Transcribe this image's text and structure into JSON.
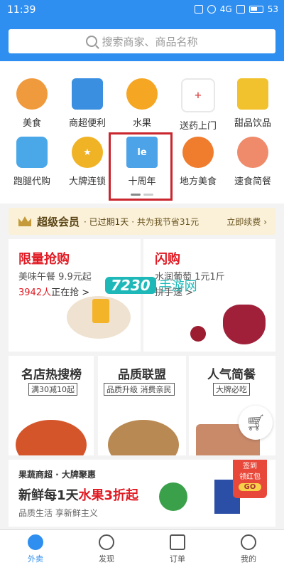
{
  "status": {
    "time": "11:39",
    "network": "4G",
    "battery": "53"
  },
  "search": {
    "placeholder": "搜索商家、商品名称"
  },
  "categories": [
    {
      "label": "美食",
      "icon": "food-icon",
      "color": "#f09a3e"
    },
    {
      "label": "商超便利",
      "icon": "store-icon",
      "color": "#3a8fe0"
    },
    {
      "label": "水果",
      "icon": "orange-icon",
      "color": "#f5a623"
    },
    {
      "label": "送药上门",
      "icon": "medicine-icon",
      "color": "#e05050"
    },
    {
      "label": "甜品饮品",
      "icon": "drink-icon",
      "color": "#f2c12e"
    },
    {
      "label": "跑腿代购",
      "icon": "errand-icon",
      "color": "#4aa8e8"
    },
    {
      "label": "大牌连锁",
      "icon": "star-icon",
      "color": "#f0b326"
    },
    {
      "label": "十周年",
      "icon": "anniversary-icon",
      "color": "#4da3e8",
      "badge": "le"
    },
    {
      "label": "地方美食",
      "icon": "bowl-icon",
      "color": "#f07c2e"
    },
    {
      "label": "速食简餐",
      "icon": "fastfood-icon",
      "color": "#ef8a6a"
    }
  ],
  "vip": {
    "title": "超级会员",
    "expired": "· 已过期1天",
    "saved": "· 共为我节省31元",
    "action": "立即续费 ›"
  },
  "flash_sale": {
    "title": "限量抢购",
    "sub": "美味午餐 9.9元起",
    "count": "3942人",
    "count_suffix": "正在抢 >"
  },
  "flash_buy": {
    "title": "闪购",
    "sub": "水润葡萄 1元1斤",
    "link": "拼手速 >"
  },
  "hot": [
    {
      "title": "名店热搜榜",
      "tag": "满30减10起"
    },
    {
      "title": "品质联盟",
      "tag": "品质升级 消费亲民"
    },
    {
      "title": "人气简餐",
      "tag": "大牌必吃"
    }
  ],
  "fresh": {
    "pre": "果蔬商超 · 大牌聚惠",
    "title_a": "新鲜每1天",
    "title_b": "水果3折起",
    "sub": "品质生活 享新鲜主义",
    "sign_top": "签到",
    "sign_mid": "领红包",
    "sign_go": "GO"
  },
  "watermark": {
    "num": "7230",
    "text": "手游网"
  },
  "tabs": [
    {
      "label": "外卖"
    },
    {
      "label": "发现"
    },
    {
      "label": "订单"
    },
    {
      "label": "我的"
    }
  ]
}
